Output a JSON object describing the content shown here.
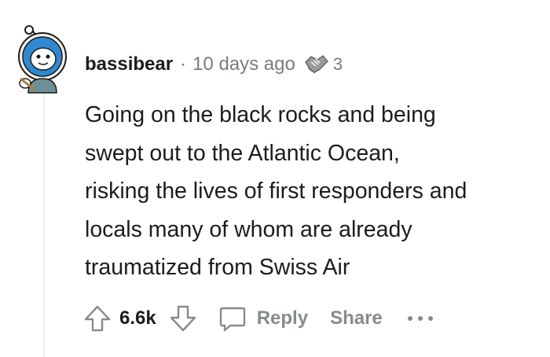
{
  "comment": {
    "username": "bassibear",
    "separator": "·",
    "timestamp": "10 days ago",
    "award_count": "3",
    "body_lines": [
      "Going on the black rocks and being",
      "swept out to the Atlantic Ocean,",
      "risking the lives of first responders and",
      "locals many of whom are already",
      "traumatized from Swiss Air"
    ],
    "score": "6.6k"
  },
  "actions": {
    "upvote_icon": "upvote-arrow-icon",
    "downvote_icon": "downvote-arrow-icon",
    "reply_icon": "speech-bubble-icon",
    "reply_label": "Reply",
    "share_label": "Share",
    "more_icon": "ellipsis-icon"
  },
  "colors": {
    "text": "#1c1c1c",
    "meta": "#787c7e",
    "action": "#878a8c",
    "thread_line": "#edeff1"
  }
}
